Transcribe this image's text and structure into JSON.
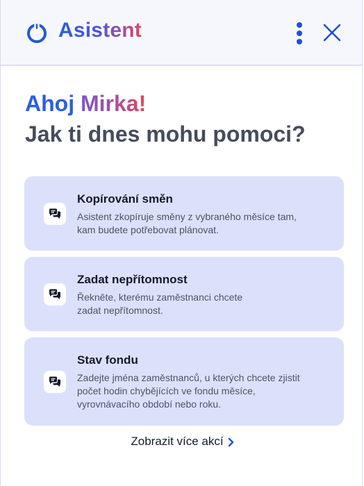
{
  "header": {
    "title": "Asistent",
    "logo_icon": "power-ring-icon",
    "menu_icon": "vertical-dots-icon",
    "close_icon": "close-icon"
  },
  "greeting": {
    "hello": "Ahoj",
    "name": "Mirka!",
    "question": "Jak ti dnes mohu pomoci?"
  },
  "actions": [
    {
      "icon": "chat-bubbles-icon",
      "title": "Kopírování směn",
      "desc_lines": [
        "Asistent zkopíruje směny z vybraného měsíce tam,",
        "kam budete potřebovat plánovat."
      ]
    },
    {
      "icon": "chat-bubbles-icon",
      "title": "Zadat nepřítomnost",
      "desc_lines": [
        "Řekněte, kterému zaměstnanci chcete",
        "zadat nepřítomnost."
      ]
    },
    {
      "icon": "chat-bubbles-icon",
      "title": "Stav fondu",
      "desc_lines": [
        "Zadejte jména zaměstnanců, u kterých chcete zjistit",
        "počet hodin chybějících ve fondu měsíce,",
        "vyrovnávacího období nebo roku."
      ]
    }
  ],
  "more": {
    "label": "Zobrazit více akcí",
    "icon": "chevron-right-icon"
  },
  "colors": {
    "accent": "#1f4fd6",
    "card_bg": "#dce1fb",
    "header_bg": "#f6f7fd",
    "gradient_end": "#e0455a"
  }
}
